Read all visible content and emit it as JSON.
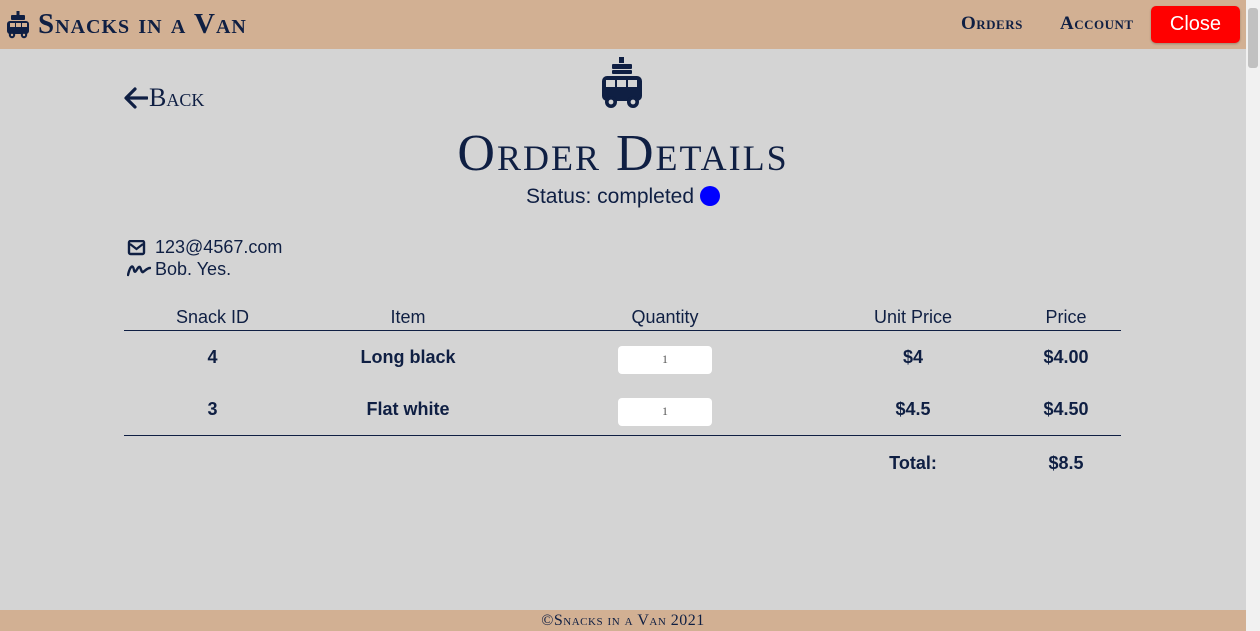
{
  "brand": {
    "name": "Snacks in a Van",
    "icon": "van-icon"
  },
  "nav": {
    "orders": "Orders",
    "account": "Account",
    "close": "Close",
    "close_color": "#ff0000"
  },
  "page": {
    "back": "Back",
    "title": "Order Details",
    "status_label": "Status: completed",
    "status_color": "#0000ff"
  },
  "customer": {
    "email": "123@4567.com",
    "name": "Bob. Yes."
  },
  "table": {
    "headers": {
      "snack_id": "Snack ID",
      "item": "Item",
      "quantity": "Quantity",
      "unit_price": "Unit Price",
      "price": "Price"
    },
    "rows": [
      {
        "snack_id": "4",
        "item": "Long black",
        "quantity": "1",
        "unit_price": "$4",
        "price": "$4.00"
      },
      {
        "snack_id": "3",
        "item": "Flat white",
        "quantity": "1",
        "unit_price": "$4.5",
        "price": "$4.50"
      }
    ],
    "total_label": "Total:",
    "total_value": "$8.5"
  },
  "footer": {
    "text": "©Snacks in a Van 2021"
  },
  "colors": {
    "navbar": "#d2b093",
    "background": "#d4d4d4",
    "text": "#0f1f43"
  }
}
